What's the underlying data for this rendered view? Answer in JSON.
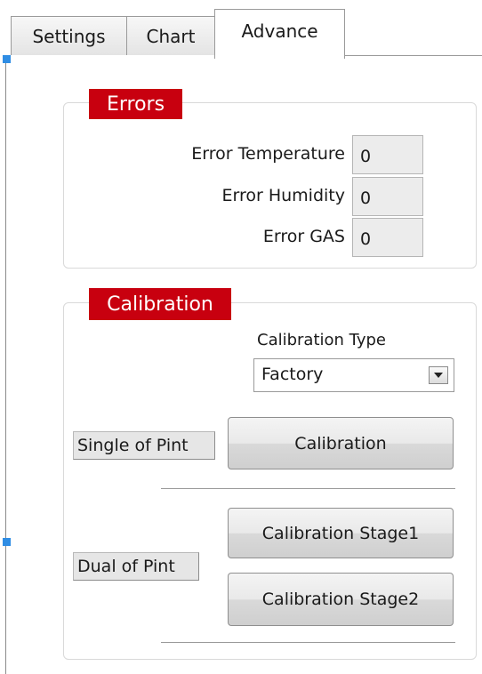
{
  "tabs": [
    {
      "label": "Settings"
    },
    {
      "label": "Chart"
    },
    {
      "label": "Advance",
      "selected": true
    }
  ],
  "errors": {
    "title": "Errors",
    "rows": [
      {
        "label": "Error Temperature",
        "value": "0"
      },
      {
        "label": "Error Humidity",
        "value": "0"
      },
      {
        "label": "Error GAS",
        "value": "0"
      }
    ]
  },
  "calibration": {
    "title": "Calibration",
    "type_label": "Calibration Type",
    "type_value": "Factory",
    "single_label": "Single of Pint",
    "calibration_button": "Calibration",
    "dual_label": "Dual of Pint",
    "stage1_button": "Calibration Stage1",
    "stage2_button": "Calibration Stage2"
  },
  "colors": {
    "group_title_bg": "#c8000f",
    "selection_handle": "#2f8de4"
  }
}
